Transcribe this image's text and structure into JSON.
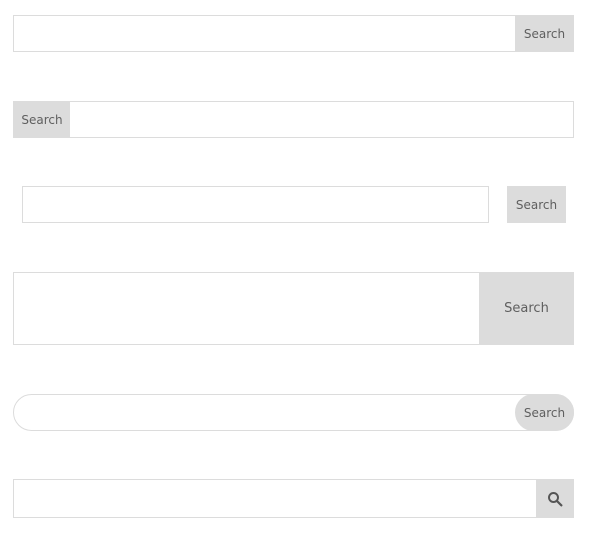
{
  "search_forms": [
    {
      "id": "row1",
      "button_label": "Search",
      "input_value": "",
      "input_placeholder": ""
    },
    {
      "id": "row2",
      "button_label": "Search",
      "input_value": "",
      "input_placeholder": ""
    },
    {
      "id": "row3",
      "button_label": "Search",
      "input_value": "",
      "input_placeholder": ""
    },
    {
      "id": "row4",
      "button_label": "Search",
      "input_value": "",
      "input_placeholder": ""
    },
    {
      "id": "row5",
      "button_label": "Search",
      "input_value": "",
      "input_placeholder": ""
    },
    {
      "id": "row6",
      "button_icon": "search-icon",
      "input_value": "",
      "input_placeholder": ""
    }
  ],
  "colors": {
    "border": "#dcdcdc",
    "button_background": "#dcdcdc",
    "button_text": "#5f5f5f",
    "icon": "#555555"
  }
}
